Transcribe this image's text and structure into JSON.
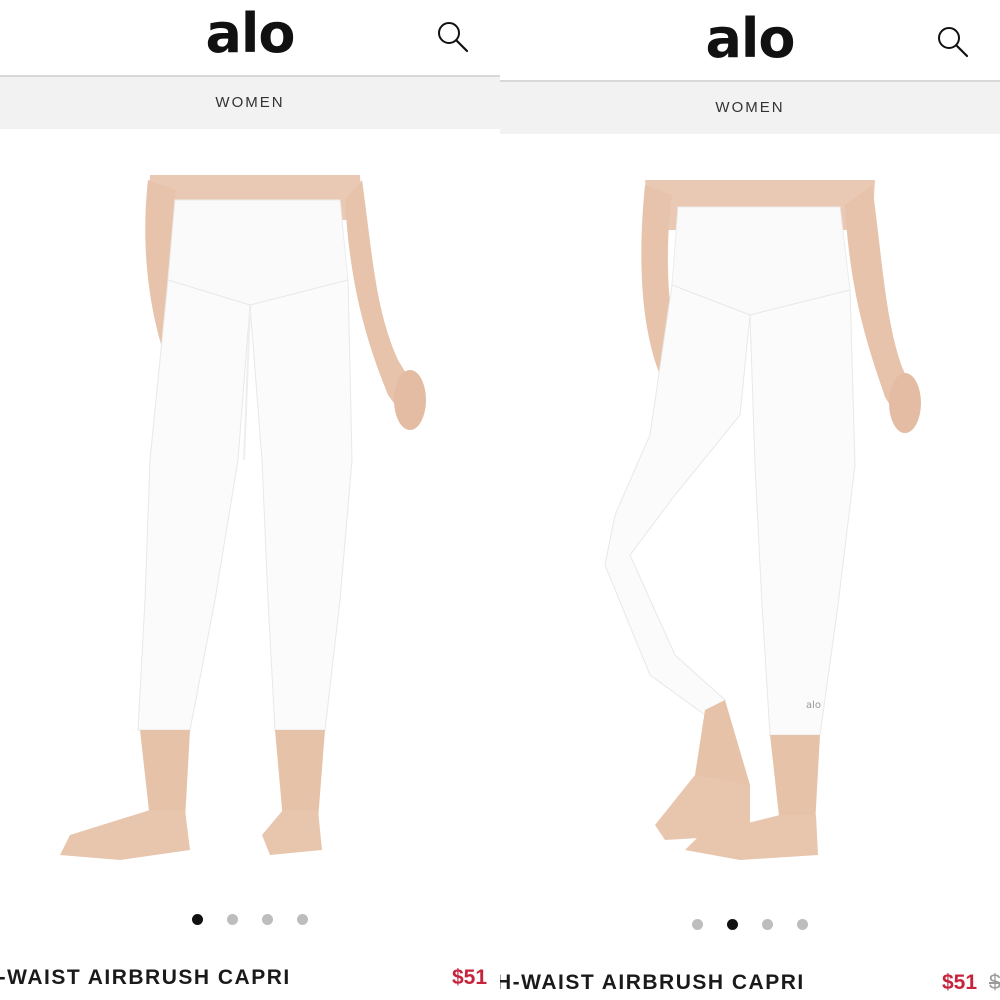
{
  "screens": [
    {
      "brand": "alo",
      "nav_category": "WOMEN",
      "product_name": "H-WAIST AIRBRUSH CAPRI",
      "price_sale": "$51",
      "price_original": "",
      "carousel": {
        "total": 4,
        "active": 1
      }
    },
    {
      "brand": "alo",
      "nav_category": "WOMEN",
      "product_name": "H-WAIST AIRBRUSH CAPRI",
      "price_sale": "$51",
      "price_original": "$",
      "carousel": {
        "total": 4,
        "active": 2
      }
    }
  ],
  "icons": {
    "search": "search-icon"
  },
  "colors": {
    "sale_price": "#c6243c",
    "active_dot": "#111111",
    "inactive_dot": "#bdbdbd",
    "category_bar": "#f2f2f2"
  }
}
